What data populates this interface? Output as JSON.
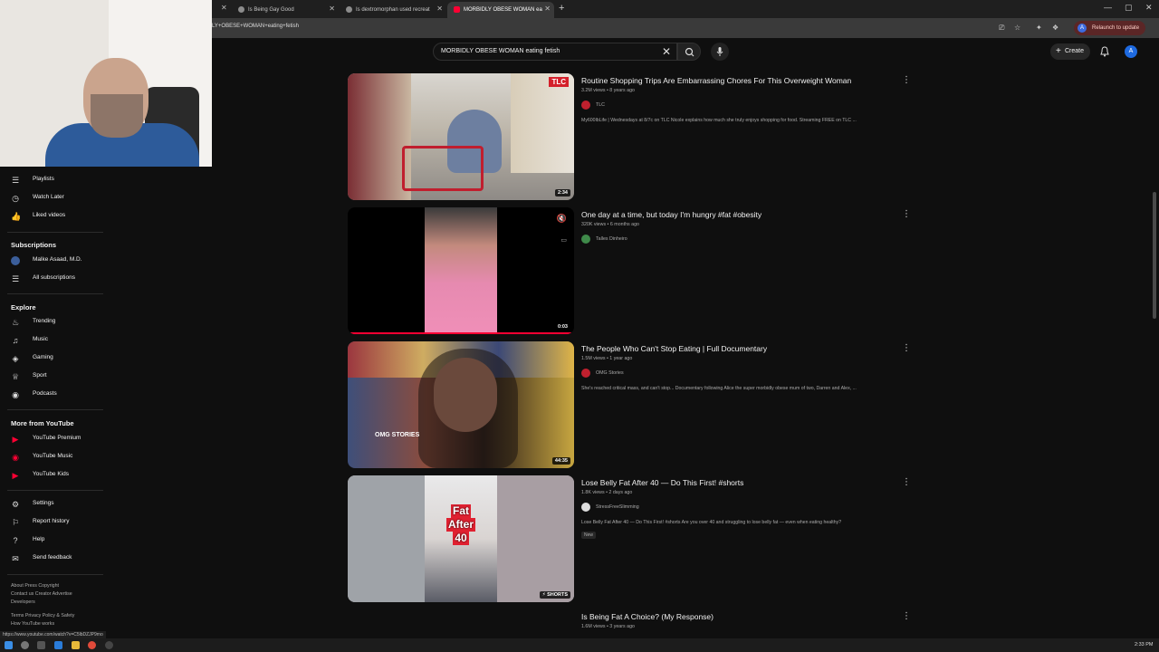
{
  "browser": {
    "tabs": [
      {
        "title": "Is Being Gay Good"
      },
      {
        "title": "Is dextromorphan used recreat"
      },
      {
        "title": "MORBIDLY OBESE WOMAN ea"
      }
    ],
    "url": "LY+OBESE+WOMAN+eating+fetish",
    "relaunch_label": "Relaunch to update",
    "profile_initial": "A"
  },
  "youtube": {
    "search_query": "MORBIDLY OBESE WOMAN eating fetish",
    "create_label": "Create",
    "avatar_initial": "A"
  },
  "sidebar": {
    "items_top": [
      {
        "label": "Playlists",
        "icon": "playlist-icon"
      },
      {
        "label": "Watch Later",
        "icon": "clock-icon"
      },
      {
        "label": "Liked videos",
        "icon": "thumbs-up-icon"
      }
    ],
    "subscriptions_header": "Subscriptions",
    "subscriptions": [
      {
        "label": "Malke Asaad, M.D."
      },
      {
        "label": "All subscriptions"
      }
    ],
    "explore_header": "Explore",
    "explore": [
      {
        "label": "Trending",
        "icon": "fire-icon"
      },
      {
        "label": "Music",
        "icon": "music-note-icon"
      },
      {
        "label": "Gaming",
        "icon": "gamepad-icon"
      },
      {
        "label": "Sport",
        "icon": "trophy-icon"
      },
      {
        "label": "Podcasts",
        "icon": "podcast-icon"
      }
    ],
    "more_header": "More from YouTube",
    "more": [
      {
        "label": "YouTube Premium"
      },
      {
        "label": "YouTube Music"
      },
      {
        "label": "YouTube Kids"
      }
    ],
    "settings": [
      {
        "label": "Settings",
        "icon": "gear-icon"
      },
      {
        "label": "Report history",
        "icon": "flag-icon"
      },
      {
        "label": "Help",
        "icon": "help-icon"
      },
      {
        "label": "Send feedback",
        "icon": "feedback-icon"
      }
    ],
    "footer_line1": "About  Press  Copyright",
    "footer_line2": "Contact us  Creator  Advertise",
    "footer_line3": "Developers",
    "footer_line4": "Terms  Privacy  Policy & Safety",
    "footer_line5": "How YouTube works",
    "status_url": "https://www.youtube.com/watch?v=C5lbDZJP9mo"
  },
  "results": [
    {
      "title": "Routine Shopping Trips Are Embarrassing Chores For This Overweight Woman",
      "meta": "3.2M views • 8 years ago",
      "channel": "TLC",
      "description": "My600lbLife | Wednesdays at 8/7c on TLC Nicole explains how much she truly enjoys shopping for food. Streaming FREE on TLC ...",
      "duration": "2:34"
    },
    {
      "title": "One day at a time, but today I'm hungry #fat #obesity",
      "meta": "320K views • 6 months ago",
      "channel": "Talles Dinheiro",
      "description": "",
      "duration": "0:03"
    },
    {
      "title": "The People Who Can't Stop Eating | Full Documentary",
      "meta": "1.5M views • 1 year ago",
      "channel": "OMG Stories",
      "description": "She's reached critical mass, and can't stop... Documentary following Alice the super morbidly obese mum of two, Darren and Alex, ...",
      "duration": "44:35",
      "thumb_text": "OMG STORIES"
    },
    {
      "title": "Lose Belly Fat After 40 — Do This First! #shorts",
      "meta": "1.8K views • 2 days ago",
      "channel": "StressFreeSlimming",
      "description": "Lose Belly Fat After 40 — Do This First! #shorts Are you over 40 and struggling to lose belly fat — even when eating healthy?",
      "badge": "New",
      "duration": "SHORTS",
      "thumb_text_1": "Fat",
      "thumb_text_2": "After",
      "thumb_text_3": "40"
    },
    {
      "title": "Is Being Fat A Choice? (My Response)",
      "meta": "1.6M views • 3 years ago"
    }
  ],
  "taskbar": {
    "clock": "2:33 PM"
  }
}
